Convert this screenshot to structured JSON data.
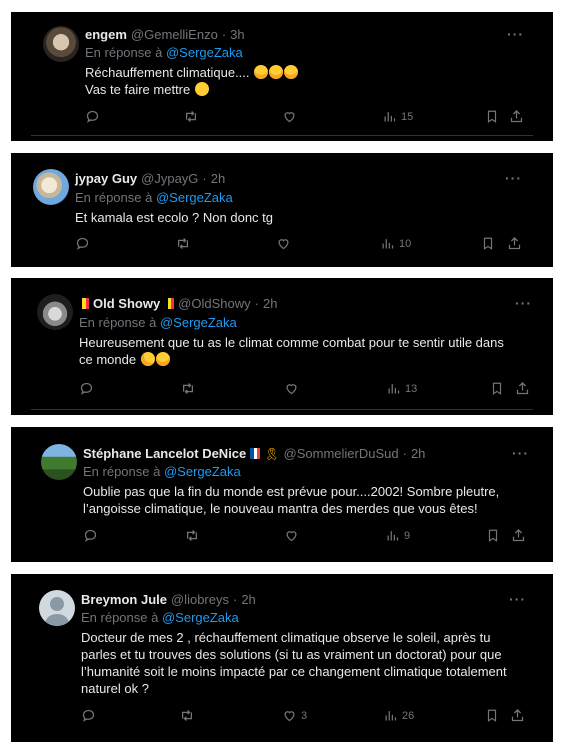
{
  "posts": [
    {
      "name": "engem",
      "handle": "@GemelliEnzo",
      "dot": "·",
      "time": "3h",
      "reply_prefix": "En réponse à",
      "reply_mention": "@SergeZaka",
      "lines": [
        "Réchauffement climatique....",
        "Vas te faire mettre"
      ],
      "emojis": [
        [
          "laughing-crying",
          "laughing-crying",
          "laughing-crying"
        ],
        [
          "slightly-smiling"
        ]
      ],
      "views": "15",
      "likes": ""
    },
    {
      "name": "jypay Guy",
      "handle": "@JypayG",
      "dot": "·",
      "time": "2h",
      "reply_prefix": "En réponse à",
      "reply_mention": "@SergeZaka",
      "lines": [
        "Et kamala est ecolo ? Non donc tg"
      ],
      "views": "10",
      "likes": ""
    },
    {
      "name": "Old Showy",
      "handle": "@OldShowy",
      "dot": "·",
      "time": "2h",
      "reply_prefix": "En réponse à",
      "reply_mention": "@SergeZaka",
      "lines": [
        "Heureusement que tu as le climat comme combat pour te sentir utile dans",
        "ce monde"
      ],
      "emojis": [
        [],
        [
          "rolling-laughing",
          "laughing-crying"
        ]
      ],
      "views": "13",
      "likes": ""
    },
    {
      "name": "Stéphane Lancelot DeNice",
      "handle": "@SommelierDuSud",
      "dot": "·",
      "time": "2h",
      "reply_prefix": "En réponse à",
      "reply_mention": "@SergeZaka",
      "lines": [
        "Oublie pas que la fin du monde est prévue pour....2002! Sombre pleutre,",
        "l’angoisse climatique, le nouveau mantra des merdes que vous êtes!"
      ],
      "views": "9",
      "likes": ""
    },
    {
      "name": "Breymon Jule",
      "handle": "@liobreys",
      "dot": "·",
      "time": "2h",
      "reply_prefix": "En réponse à",
      "reply_mention": "@SergeZaka",
      "lines": [
        "Docteur de mes 2 , réchauffement climatique observe le soleil, après tu",
        "parles et tu trouves des solutions (si tu as vraiment un doctorat) pour que",
        "l’humanité soit le moins impacté par ce changement climatique totalement",
        "naturel ok ?"
      ],
      "views": "26",
      "likes": "3"
    }
  ],
  "more_label": "···",
  "colors": {
    "background": "#000000",
    "text": "#e7e9ea",
    "muted": "#71767b",
    "link": "#1d9bf0"
  }
}
